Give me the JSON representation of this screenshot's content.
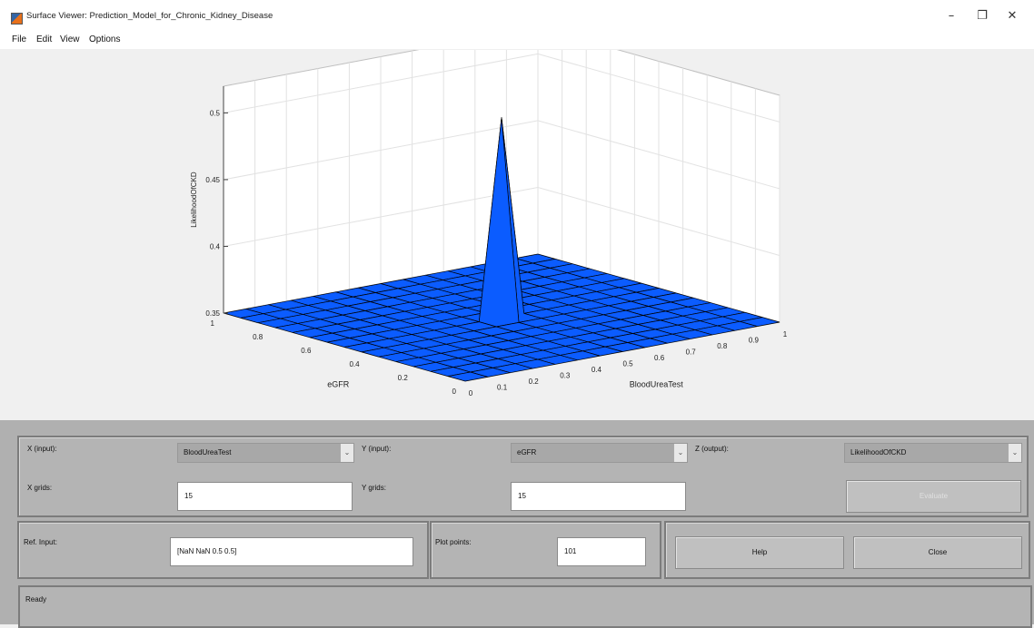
{
  "window": {
    "title": "Surface Viewer: Prediction_Model_for_Chronic_Kidney_Disease",
    "minimize_glyph": "–",
    "maximize_glyph": "❐",
    "close_glyph": "✕"
  },
  "menu": [
    "File",
    "Edit",
    "View",
    "Options"
  ],
  "controls": {
    "x_label": "X (input):",
    "x_value": "BloodUreaTest",
    "y_label": "Y (input):",
    "y_value": "eGFR",
    "z_label": "Z (output):",
    "z_value": "LikelihoodOfCKD",
    "x_grids_label": "X grids:",
    "x_grids_value": "15",
    "y_grids_label": "Y grids:",
    "y_grids_value": "15",
    "evaluate_label": "Evaluate",
    "ref_input_label": "Ref. Input:",
    "ref_input_value": "[NaN NaN 0.5 0.5]",
    "plot_points_label": "Plot points:",
    "plot_points_value": "101",
    "help_label": "Help",
    "close_label": "Close",
    "dropdown_arrow": "⌄"
  },
  "status": "Ready",
  "chart_data": {
    "type": "surface",
    "xlabel": "BloodUreaTest",
    "ylabel": "eGFR",
    "zlabel": "LikelihoodOfCKD",
    "x_ticks": [
      "0",
      "0.1",
      "0.2",
      "0.3",
      "0.4",
      "0.5",
      "0.6",
      "0.7",
      "0.8",
      "0.9",
      "1"
    ],
    "y_ticks": [
      "0",
      "0.2",
      "0.4",
      "0.6",
      "0.8",
      "1"
    ],
    "z_ticks": [
      "0.35",
      "0.4",
      "0.45",
      "0.5"
    ],
    "xlim": [
      0,
      1
    ],
    "ylim": [
      0,
      1
    ],
    "zlim": [
      0.35,
      0.52
    ],
    "grid": true,
    "base_value": 0.35,
    "peak": {
      "x": [
        0.43,
        0.5
      ],
      "y": [
        0.5,
        0.57
      ],
      "value": 0.5
    },
    "surface_color": "#0b5cff",
    "peak_color": "#f2f200"
  }
}
